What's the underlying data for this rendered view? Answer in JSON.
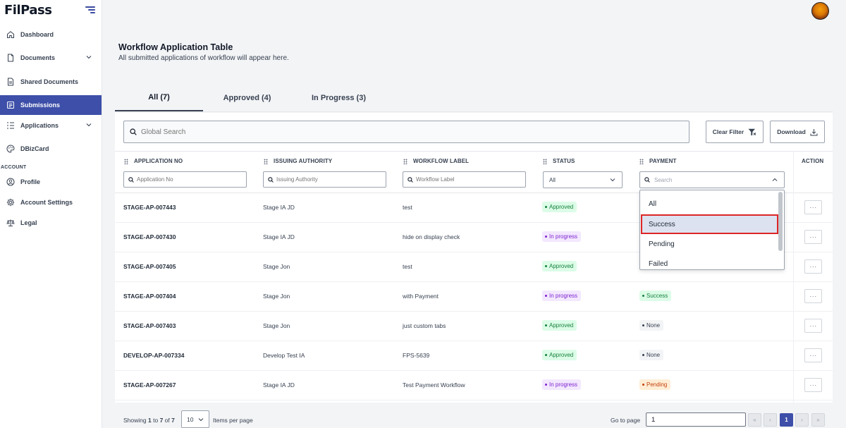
{
  "app": {
    "logo": "FilPass"
  },
  "sidebar": {
    "items": [
      {
        "label": "Dashboard",
        "icon": "home-icon"
      },
      {
        "label": "Documents",
        "icon": "document-icon"
      },
      {
        "label": "Shared Documents",
        "icon": "shared-document-icon"
      },
      {
        "label": "Submissions",
        "icon": "submissions-icon"
      },
      {
        "label": "Applications",
        "icon": "applications-icon"
      },
      {
        "label": "DBizCard",
        "icon": "palette-icon"
      }
    ],
    "section_label": "ACCOUNT",
    "account_items": [
      {
        "label": "Profile",
        "icon": "user-icon"
      },
      {
        "label": "Account Settings",
        "icon": "gear-icon"
      },
      {
        "label": "Legal",
        "icon": "scale-icon"
      }
    ]
  },
  "header": {
    "title": "Workflow Application Table",
    "subtitle": "All submitted applications of workflow will appear here."
  },
  "tabs": [
    {
      "label": "All (7)",
      "active": true
    },
    {
      "label": "Approved (4)",
      "active": false
    },
    {
      "label": "In Progress (3)",
      "active": false
    }
  ],
  "toolbar": {
    "search_placeholder": "Global Search",
    "clear_filter_label": "Clear Filter",
    "download_label": "Download"
  },
  "table": {
    "columns": [
      "APPLICATION NO",
      "ISSUING AUTHORITY",
      "WORKFLOW LABEL",
      "STATUS",
      "PAYMENT",
      "ACTION"
    ],
    "filters": {
      "application_no_placeholder": "Application No",
      "issuing_authority_placeholder": "Issuing Authority",
      "workflow_label_placeholder": "Workflow Label",
      "status_value": "All",
      "payment_placeholder": "Search"
    },
    "rows": [
      {
        "app_no": "STAGE-AP-007443",
        "authority": "Stage IA JD",
        "label": "test",
        "status": "Approved",
        "payment": ""
      },
      {
        "app_no": "STAGE-AP-007430",
        "authority": "Stage IA JD",
        "label": "hide on display check",
        "status": "In progress",
        "payment": ""
      },
      {
        "app_no": "STAGE-AP-007405",
        "authority": "Stage Jon",
        "label": "test",
        "status": "Approved",
        "payment": ""
      },
      {
        "app_no": "STAGE-AP-007404",
        "authority": "Stage Jon",
        "label": "with Payment",
        "status": "In progress",
        "payment": "Success"
      },
      {
        "app_no": "STAGE-AP-007403",
        "authority": "Stage Jon",
        "label": "just custom tabs",
        "status": "Approved",
        "payment": "None"
      },
      {
        "app_no": "DEVELOP-AP-007334",
        "authority": "Develop Test IA",
        "label": "FPS-5639",
        "status": "Approved",
        "payment": "None"
      },
      {
        "app_no": "STAGE-AP-007267",
        "authority": "Stage IA JD",
        "label": "Test Payment Workflow",
        "status": "In progress",
        "payment": "Pending"
      }
    ],
    "action_label": "···"
  },
  "payment_dropdown": {
    "options": [
      "All",
      "Success",
      "Pending",
      "Failed"
    ],
    "highlighted": "Success"
  },
  "pagination": {
    "showing_prefix": "Showing",
    "from": "1",
    "to_word": "to",
    "to": "7",
    "of_word": "of",
    "total": "7",
    "per_page": "10",
    "items_per_page_label": "Items per page",
    "go_to_page_label": "Go to page",
    "go_to_value": "1",
    "current_page": "1",
    "first": "«",
    "prev": "‹",
    "next": "›",
    "last": "»"
  },
  "colors": {
    "accent": "#3d4fa8",
    "approved": "#15803d",
    "in_progress": "#7e22ce",
    "pending": "#c2410c",
    "highlight_border": "#dc2626"
  }
}
